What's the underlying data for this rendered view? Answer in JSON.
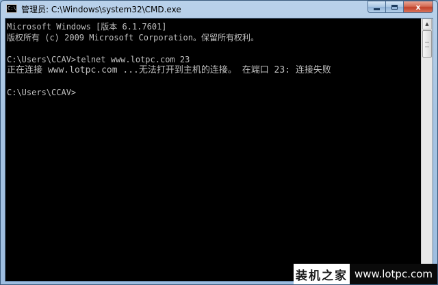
{
  "window": {
    "title": "管理员: C:\\Windows\\system32\\CMD.exe",
    "icon_text": "C:\\",
    "buttons": {
      "minimize": "minimize",
      "maximize": "maximize",
      "close": "x"
    }
  },
  "console": {
    "lines": [
      "Microsoft Windows [版本 6.1.7601]",
      "版权所有 (c) 2009 Microsoft Corporation。保留所有权利。",
      "",
      "C:\\Users\\CCAV>telnet www.lotpc.com 23",
      "正在连接 www.lotpc.com ...无法打开到主机的连接。 在端口 23: 连接失败",
      "",
      "C:\\Users\\CCAV>"
    ]
  },
  "watermark": {
    "brand": "装机之家",
    "site": "www.lotpc.com"
  },
  "colors": {
    "console_bg": "#000000",
    "console_fg": "#c0c0c0",
    "close_button": "#c1412a",
    "titlebar": "#a7c4e2"
  },
  "icons": {
    "app": "cmd-icon",
    "min": "minimize-icon",
    "max": "maximize-icon",
    "close": "close-icon",
    "scroll_up": "scroll-up-arrow-icon",
    "scroll_down": "scroll-down-arrow-icon"
  }
}
